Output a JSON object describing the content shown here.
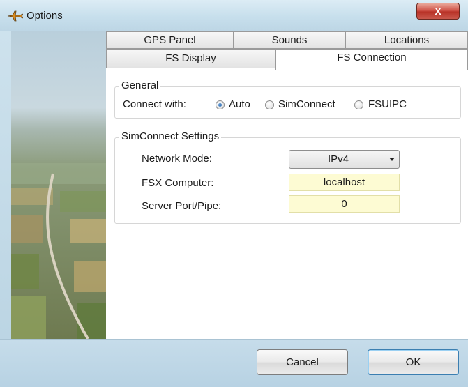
{
  "window": {
    "title": "Options",
    "close_label": "X"
  },
  "tabs": {
    "row1": [
      "GPS Panel",
      "Sounds",
      "Locations"
    ],
    "row2": [
      "FS Display",
      "FS Connection"
    ],
    "active": "FS Connection"
  },
  "general": {
    "title": "General",
    "connect_label": "Connect with:",
    "options": [
      "Auto",
      "SimConnect",
      "FSUIPC"
    ],
    "selected": "Auto"
  },
  "simconnect": {
    "title": "SimConnect Settings",
    "network_mode_label": "Network Mode:",
    "network_mode_value": "IPv4",
    "fsx_computer_label": "FSX Computer:",
    "fsx_computer_value": "localhost",
    "server_port_label": "Server Port/Pipe:",
    "server_port_value": "0"
  },
  "buttons": {
    "cancel": "Cancel",
    "ok": "OK"
  },
  "colors": {
    "field_bg": "#fdfbd3",
    "accent": "#1f5fa8",
    "close": "#c8463b"
  },
  "icons": {
    "title": "plane-icon",
    "dropdown": "chevron-down-icon"
  }
}
